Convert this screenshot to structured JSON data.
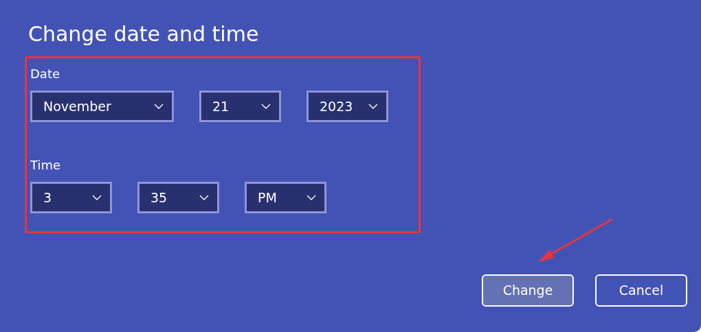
{
  "title": "Change date and time",
  "form": {
    "highlighted": true,
    "sections": [
      {
        "label": "Date",
        "dropdowns": [
          {
            "value": "November",
            "kind": "month"
          },
          {
            "value": "21",
            "kind": "day"
          },
          {
            "value": "2023",
            "kind": "year"
          }
        ]
      },
      {
        "label": "Time",
        "dropdowns": [
          {
            "value": "3",
            "kind": "hour"
          },
          {
            "value": "35",
            "kind": "minute"
          },
          {
            "value": "PM",
            "kind": "period"
          }
        ]
      }
    ]
  },
  "buttons": [
    {
      "label": "Change",
      "kind": "primary"
    },
    {
      "label": "Cancel",
      "kind": "secondary"
    }
  ],
  "annotations": [
    {
      "kind": "arrow"
    }
  ]
}
